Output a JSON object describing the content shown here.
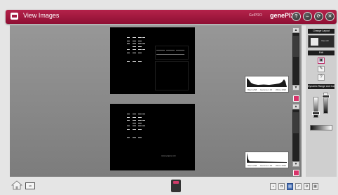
{
  "window": {
    "title": "View Images",
    "brand_small": "GelPRO",
    "brand_main": "genePIX",
    "buttons": [
      {
        "label": "?",
        "icon": "help-icon"
      },
      {
        "label": "–",
        "icon": "minimize-icon"
      },
      {
        "label": "⟳",
        "icon": "refresh-icon"
      },
      {
        "label": "✕",
        "icon": "close-icon"
      }
    ]
  },
  "right_panel": {
    "change_layout_label": "Change Layout",
    "layout_option_label": "View All",
    "edit_label": "Edit",
    "tools": [
      {
        "icon": "select-icon",
        "glyph": "▣"
      },
      {
        "icon": "brush-icon",
        "glyph": "✎"
      },
      {
        "icon": "help-icon",
        "glyph": "?"
      }
    ],
    "dynamic_range_label": "Dynamic Range and Contrast"
  },
  "histograms": [
    {
      "labels": [
        "Black 258",
        "Gamma 1.00",
        "White 4095"
      ]
    },
    {
      "labels": [
        "Black 258",
        "Gamma 1.00",
        "White 4095"
      ]
    }
  ],
  "watermark": "www.syngene.com",
  "bottom": {
    "home_icon": "home-icon",
    "monitor_label": "HD",
    "gel_icon": "gel-icon",
    "tray_icons": [
      "save-icon",
      "camera-icon",
      "print-icon",
      "export-icon",
      "settings-icon",
      "image-icon"
    ]
  },
  "colors": {
    "accent": "#a31a42",
    "pink": "#d8336a"
  }
}
